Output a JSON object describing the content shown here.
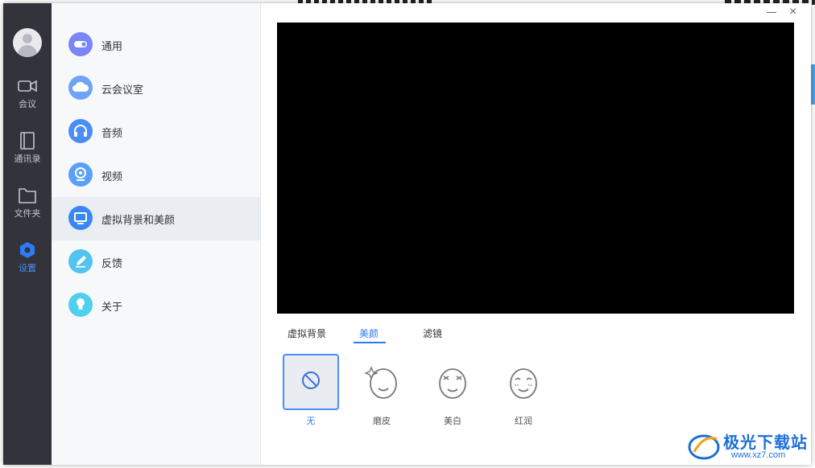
{
  "rail": {
    "items": [
      {
        "label": "会议",
        "icon": "video-camera-icon"
      },
      {
        "label": "通讯录",
        "icon": "address-book-icon"
      },
      {
        "label": "文件夹",
        "icon": "folder-icon"
      },
      {
        "label": "设置",
        "icon": "gear-icon",
        "active": true
      }
    ]
  },
  "menu": {
    "items": [
      {
        "label": "通用",
        "icon": "toggle-icon",
        "color": "#7b86f5"
      },
      {
        "label": "云会议室",
        "icon": "cloud-icon",
        "color": "#6fa3f7"
      },
      {
        "label": "音频",
        "icon": "headphones-icon",
        "color": "#4a8df8"
      },
      {
        "label": "视频",
        "icon": "webcam-icon",
        "color": "#5aa0f8"
      },
      {
        "label": "虚拟背景和美颜",
        "icon": "monitor-icon",
        "color": "#3a86f5",
        "active": true
      },
      {
        "label": "反馈",
        "icon": "pencil-icon",
        "color": "#52c4ee"
      },
      {
        "label": "关于",
        "icon": "lightbulb-icon",
        "color": "#4fd0ef"
      }
    ]
  },
  "tabs": [
    {
      "label": "虚拟背景"
    },
    {
      "label": "美颜",
      "active": true
    },
    {
      "label": "滤镜"
    }
  ],
  "beauty_options": [
    {
      "label": "无",
      "icon": "no-effect-icon",
      "selected": true
    },
    {
      "label": "磨皮",
      "icon": "smooth-skin-face-icon"
    },
    {
      "label": "美白",
      "icon": "whitening-face-icon"
    },
    {
      "label": "红润",
      "icon": "rosy-face-icon"
    }
  ],
  "window": {
    "close": "×"
  },
  "watermark": {
    "title": "极光下载站",
    "url": "www.xz7.com"
  },
  "colors": {
    "accent": "#2d7bf5",
    "rail": "#33333c",
    "menu_bg": "#f7f8fa"
  }
}
